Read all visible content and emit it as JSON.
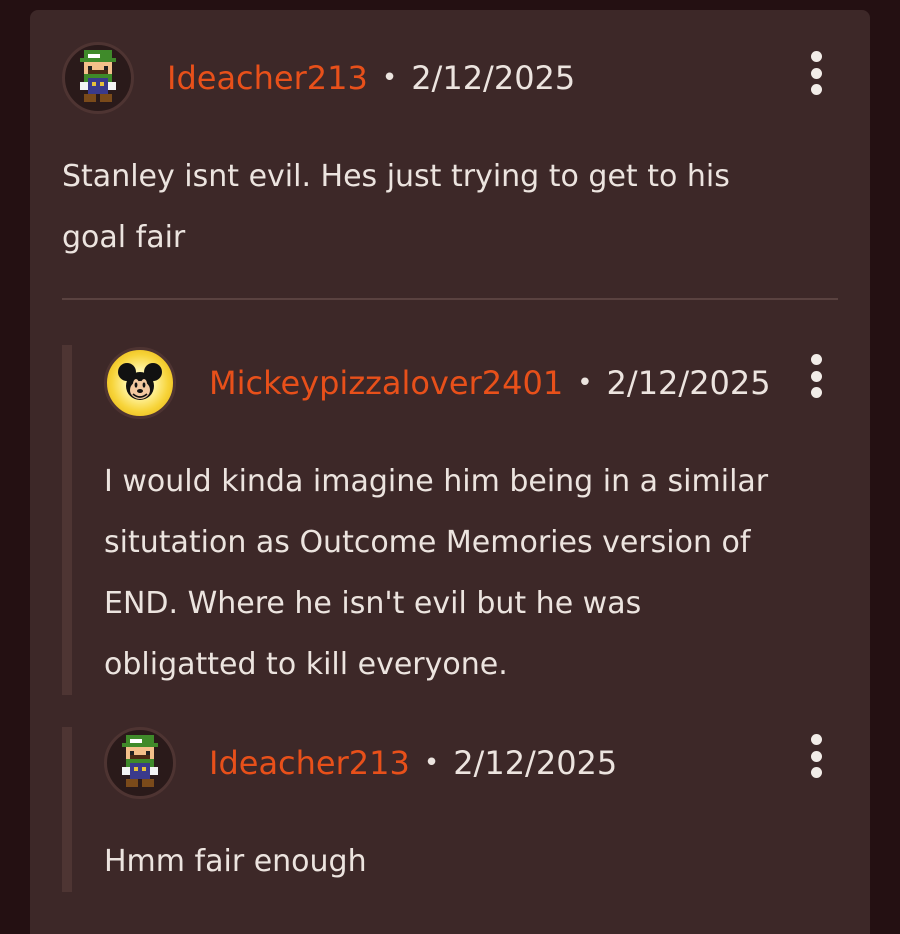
{
  "comments": [
    {
      "username": "Ideacher213",
      "separator": "•",
      "date": "2/12/2025",
      "avatar_icon": "luigi-pixel-avatar",
      "lines": [
        "Stanley isnt evil. Hes just trying to get to his",
        "goal fair"
      ]
    },
    {
      "username": "Mickeypizzalover2401",
      "separator": "•",
      "date": "2/12/2025",
      "avatar_icon": "mickey-mouse-avatar",
      "lines": [
        "I would kinda imagine him being in a similar",
        "situtation as Outcome Memories version of",
        "END. Where he isn't evil but he was",
        "obligatted to kill everyone."
      ]
    },
    {
      "username": "Ideacher213",
      "separator": "•",
      "date": "2/12/2025",
      "avatar_icon": "luigi-pixel-avatar",
      "lines": [
        "Hmm fair enough"
      ]
    }
  ],
  "colors": {
    "page_background": "#241012",
    "card_background": "#3d2828",
    "username": "#e8501a",
    "text": "#ece4df",
    "rail": "#4e3533"
  }
}
